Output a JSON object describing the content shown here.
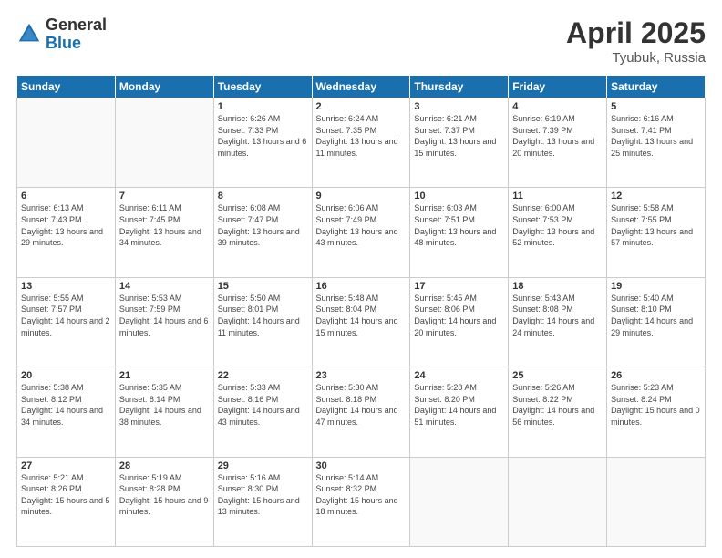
{
  "header": {
    "logo_general": "General",
    "logo_blue": "Blue",
    "title": "April 2025",
    "location": "Tyubuk, Russia"
  },
  "calendar": {
    "days_of_week": [
      "Sunday",
      "Monday",
      "Tuesday",
      "Wednesday",
      "Thursday",
      "Friday",
      "Saturday"
    ],
    "weeks": [
      [
        {
          "day": "",
          "info": ""
        },
        {
          "day": "",
          "info": ""
        },
        {
          "day": "1",
          "info": "Sunrise: 6:26 AM\nSunset: 7:33 PM\nDaylight: 13 hours and 6 minutes."
        },
        {
          "day": "2",
          "info": "Sunrise: 6:24 AM\nSunset: 7:35 PM\nDaylight: 13 hours and 11 minutes."
        },
        {
          "day": "3",
          "info": "Sunrise: 6:21 AM\nSunset: 7:37 PM\nDaylight: 13 hours and 15 minutes."
        },
        {
          "day": "4",
          "info": "Sunrise: 6:19 AM\nSunset: 7:39 PM\nDaylight: 13 hours and 20 minutes."
        },
        {
          "day": "5",
          "info": "Sunrise: 6:16 AM\nSunset: 7:41 PM\nDaylight: 13 hours and 25 minutes."
        }
      ],
      [
        {
          "day": "6",
          "info": "Sunrise: 6:13 AM\nSunset: 7:43 PM\nDaylight: 13 hours and 29 minutes."
        },
        {
          "day": "7",
          "info": "Sunrise: 6:11 AM\nSunset: 7:45 PM\nDaylight: 13 hours and 34 minutes."
        },
        {
          "day": "8",
          "info": "Sunrise: 6:08 AM\nSunset: 7:47 PM\nDaylight: 13 hours and 39 minutes."
        },
        {
          "day": "9",
          "info": "Sunrise: 6:06 AM\nSunset: 7:49 PM\nDaylight: 13 hours and 43 minutes."
        },
        {
          "day": "10",
          "info": "Sunrise: 6:03 AM\nSunset: 7:51 PM\nDaylight: 13 hours and 48 minutes."
        },
        {
          "day": "11",
          "info": "Sunrise: 6:00 AM\nSunset: 7:53 PM\nDaylight: 13 hours and 52 minutes."
        },
        {
          "day": "12",
          "info": "Sunrise: 5:58 AM\nSunset: 7:55 PM\nDaylight: 13 hours and 57 minutes."
        }
      ],
      [
        {
          "day": "13",
          "info": "Sunrise: 5:55 AM\nSunset: 7:57 PM\nDaylight: 14 hours and 2 minutes."
        },
        {
          "day": "14",
          "info": "Sunrise: 5:53 AM\nSunset: 7:59 PM\nDaylight: 14 hours and 6 minutes."
        },
        {
          "day": "15",
          "info": "Sunrise: 5:50 AM\nSunset: 8:01 PM\nDaylight: 14 hours and 11 minutes."
        },
        {
          "day": "16",
          "info": "Sunrise: 5:48 AM\nSunset: 8:04 PM\nDaylight: 14 hours and 15 minutes."
        },
        {
          "day": "17",
          "info": "Sunrise: 5:45 AM\nSunset: 8:06 PM\nDaylight: 14 hours and 20 minutes."
        },
        {
          "day": "18",
          "info": "Sunrise: 5:43 AM\nSunset: 8:08 PM\nDaylight: 14 hours and 24 minutes."
        },
        {
          "day": "19",
          "info": "Sunrise: 5:40 AM\nSunset: 8:10 PM\nDaylight: 14 hours and 29 minutes."
        }
      ],
      [
        {
          "day": "20",
          "info": "Sunrise: 5:38 AM\nSunset: 8:12 PM\nDaylight: 14 hours and 34 minutes."
        },
        {
          "day": "21",
          "info": "Sunrise: 5:35 AM\nSunset: 8:14 PM\nDaylight: 14 hours and 38 minutes."
        },
        {
          "day": "22",
          "info": "Sunrise: 5:33 AM\nSunset: 8:16 PM\nDaylight: 14 hours and 43 minutes."
        },
        {
          "day": "23",
          "info": "Sunrise: 5:30 AM\nSunset: 8:18 PM\nDaylight: 14 hours and 47 minutes."
        },
        {
          "day": "24",
          "info": "Sunrise: 5:28 AM\nSunset: 8:20 PM\nDaylight: 14 hours and 51 minutes."
        },
        {
          "day": "25",
          "info": "Sunrise: 5:26 AM\nSunset: 8:22 PM\nDaylight: 14 hours and 56 minutes."
        },
        {
          "day": "26",
          "info": "Sunrise: 5:23 AM\nSunset: 8:24 PM\nDaylight: 15 hours and 0 minutes."
        }
      ],
      [
        {
          "day": "27",
          "info": "Sunrise: 5:21 AM\nSunset: 8:26 PM\nDaylight: 15 hours and 5 minutes."
        },
        {
          "day": "28",
          "info": "Sunrise: 5:19 AM\nSunset: 8:28 PM\nDaylight: 15 hours and 9 minutes."
        },
        {
          "day": "29",
          "info": "Sunrise: 5:16 AM\nSunset: 8:30 PM\nDaylight: 15 hours and 13 minutes."
        },
        {
          "day": "30",
          "info": "Sunrise: 5:14 AM\nSunset: 8:32 PM\nDaylight: 15 hours and 18 minutes."
        },
        {
          "day": "",
          "info": ""
        },
        {
          "day": "",
          "info": ""
        },
        {
          "day": "",
          "info": ""
        }
      ]
    ]
  }
}
